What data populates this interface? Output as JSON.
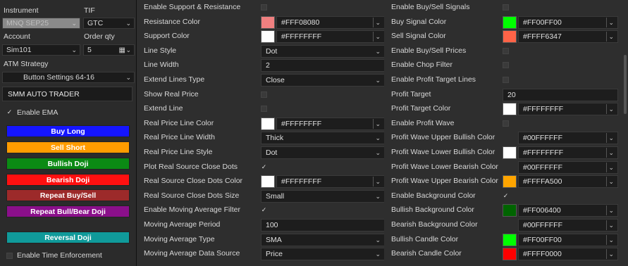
{
  "left": {
    "instrument_label": "Instrument",
    "instrument_value": "MNQ SEP25",
    "tif_label": "TIF",
    "tif_value": "GTC",
    "account_label": "Account",
    "account_value": "Sim101",
    "orderqty_label": "Order qty",
    "orderqty_value": "5",
    "atm_label": "ATM Strategy",
    "atm_value": "Button Settings 64-16",
    "title": "SMM AUTO TRADER",
    "enable_ema": "Enable EMA",
    "enable_time": "Enable Time Enforcement",
    "buttons": [
      {
        "label": "Buy Long",
        "color": "#1515ff"
      },
      {
        "label": "Sell Short",
        "color": "#ff9c00"
      },
      {
        "label": "Bullish Doji",
        "color": "#0b8a14"
      },
      {
        "label": "Bearish Doji",
        "color": "#ff1010"
      },
      {
        "label": "Repeat Buy/Sell",
        "color": "#9c2a2a"
      },
      {
        "label": "Repeat Bull/Bear Doji",
        "color": "#8a0f8a"
      },
      {
        "label": "Reversal Doji",
        "color": "#109a9a"
      }
    ]
  },
  "mid": {
    "rows": [
      {
        "label": "Enable Support & Resistance",
        "kind": "check",
        "checked": false
      },
      {
        "label": "Resistance Color",
        "kind": "color",
        "swatch": "#F08080",
        "value": "#FFF08080"
      },
      {
        "label": "Support Color",
        "kind": "color",
        "swatch": "#FFFFFF",
        "value": "#FFFFFFFF"
      },
      {
        "label": "Line Style",
        "kind": "select",
        "value": "Dot"
      },
      {
        "label": "Line Width",
        "kind": "text",
        "value": "2"
      },
      {
        "label": "Extend Lines Type",
        "kind": "select",
        "value": "Close"
      },
      {
        "label": "Show Real Price",
        "kind": "check",
        "checked": false
      },
      {
        "label": "Extend Line",
        "kind": "check",
        "checked": false
      },
      {
        "label": "Real Price Line Color",
        "kind": "color",
        "swatch": "#FFFFFF",
        "value": "#FFFFFFFF"
      },
      {
        "label": "Real Price Line Width",
        "kind": "select",
        "value": "Thick"
      },
      {
        "label": "Real Price Line Style",
        "kind": "select",
        "value": "Dot"
      },
      {
        "label": "Plot Real Source Close Dots",
        "kind": "check",
        "checked": true
      },
      {
        "label": "Real Source Close Dots Color",
        "kind": "color",
        "swatch": "#FFFFFF",
        "value": "#FFFFFFFF"
      },
      {
        "label": "Real Source Close Dots Size",
        "kind": "select",
        "value": "Small"
      },
      {
        "label": "Enable Moving Average Filter",
        "kind": "check",
        "checked": true
      },
      {
        "label": "Moving Average Period",
        "kind": "text",
        "value": "100"
      },
      {
        "label": "Moving Average Type",
        "kind": "select",
        "value": "SMA"
      },
      {
        "label": "Moving Average Data Source",
        "kind": "select",
        "value": "Price"
      }
    ]
  },
  "right": {
    "rows": [
      {
        "label": "Enable Buy/Sell Signals",
        "kind": "check",
        "checked": false
      },
      {
        "label": "Buy Signal Color",
        "kind": "color",
        "swatch": "#00FF00",
        "value": "#FF00FF00"
      },
      {
        "label": "Sell Signal Color",
        "kind": "color",
        "swatch": "#FF6347",
        "value": "#FFFF6347"
      },
      {
        "label": "Enable Buy/Sell Prices",
        "kind": "check",
        "checked": false
      },
      {
        "label": "Enable Chop Filter",
        "kind": "check",
        "checked": false
      },
      {
        "label": "Enable Profit Target Lines",
        "kind": "check",
        "checked": false
      },
      {
        "label": "Profit Target",
        "kind": "text",
        "value": "20"
      },
      {
        "label": "Profit Target Color",
        "kind": "color",
        "swatch": "#FFFFFF",
        "value": "#FFFFFFFF"
      },
      {
        "label": "Enable Profit Wave",
        "kind": "check",
        "checked": false
      },
      {
        "label": "Profit Wave Upper Bullish Color",
        "kind": "color",
        "swatch": "",
        "value": "#00FFFFFF"
      },
      {
        "label": "Profit Wave Lower Bullish Color",
        "kind": "color",
        "swatch": "#FFFFFF",
        "value": "#FFFFFFFF"
      },
      {
        "label": "Profit Wave Lower Bearish Color",
        "kind": "color",
        "swatch": "",
        "value": "#00FFFFFF"
      },
      {
        "label": "Profit Wave Upper Bearish Color",
        "kind": "color",
        "swatch": "#FFA500",
        "value": "#FFFFA500"
      },
      {
        "label": "Enable Background Color",
        "kind": "check",
        "checked": true
      },
      {
        "label": "Bullish Background Color",
        "kind": "color",
        "swatch": "#006400",
        "value": "#FF006400"
      },
      {
        "label": "Bearish Background Color",
        "kind": "color",
        "swatch": "",
        "value": "#00FFFFFF"
      },
      {
        "label": "Bullish Candle Color",
        "kind": "color",
        "swatch": "#00FF00",
        "value": "#FF00FF00"
      },
      {
        "label": "Bearish Candle Color",
        "kind": "color",
        "swatch": "#FF0000",
        "value": "#FFFF0000"
      }
    ]
  },
  "icons": {
    "chevron": "chevron-down-icon",
    "check": "checkmark-icon",
    "calc": "calculator-icon"
  }
}
